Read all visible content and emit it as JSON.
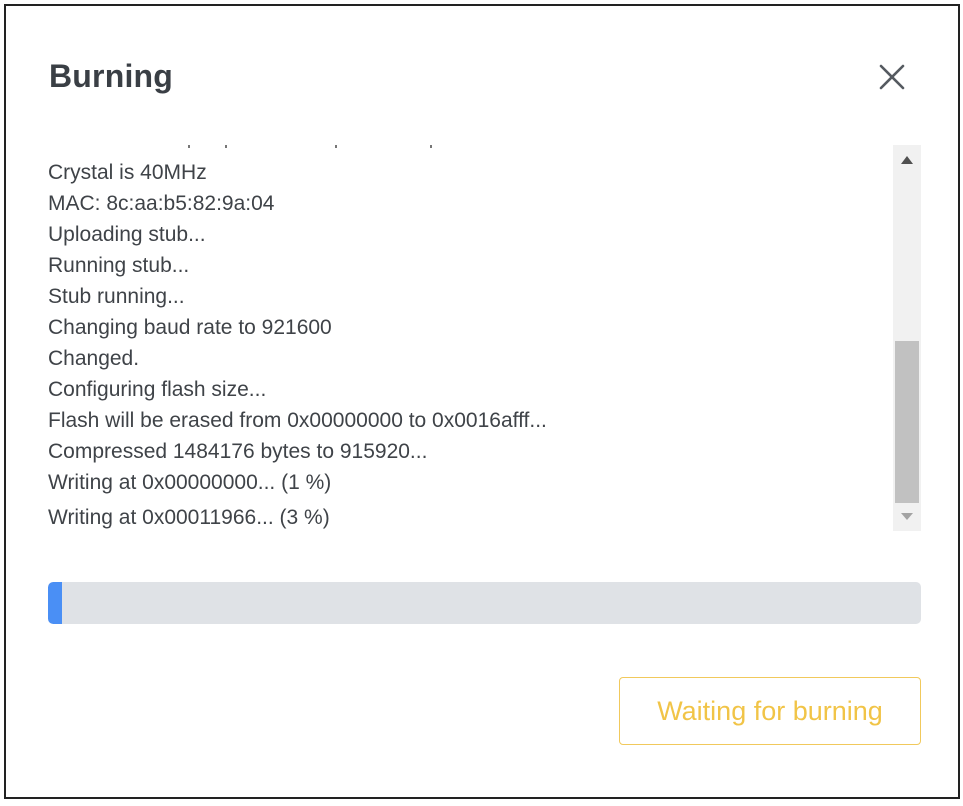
{
  "dialog": {
    "title": "Burning",
    "close_icon": "close-icon"
  },
  "log": {
    "lines": [
      "Crystal is 40MHz",
      "MAC: 8c:aa:b5:82:9a:04",
      "Uploading stub...",
      "Running stub...",
      "Stub running...",
      "Changing baud rate to 921600",
      "Changed.",
      "Configuring flash size...",
      "Flash will be erased from 0x00000000 to 0x0016afff...",
      "Compressed 1484176 bytes to 915920...",
      "Writing at 0x00000000... (1 %)",
      "Writing at 0x00011966... (3 %)"
    ],
    "scroll_up_icon": "triangle-up-icon",
    "scroll_down_icon": "triangle-down-icon"
  },
  "progress": {
    "percent": 1.6,
    "fill_color": "#4a8ff5",
    "track_color": "#dfe2e6"
  },
  "actions": {
    "waiting_label": "Waiting for burning",
    "waiting_color": "#f1c447"
  }
}
